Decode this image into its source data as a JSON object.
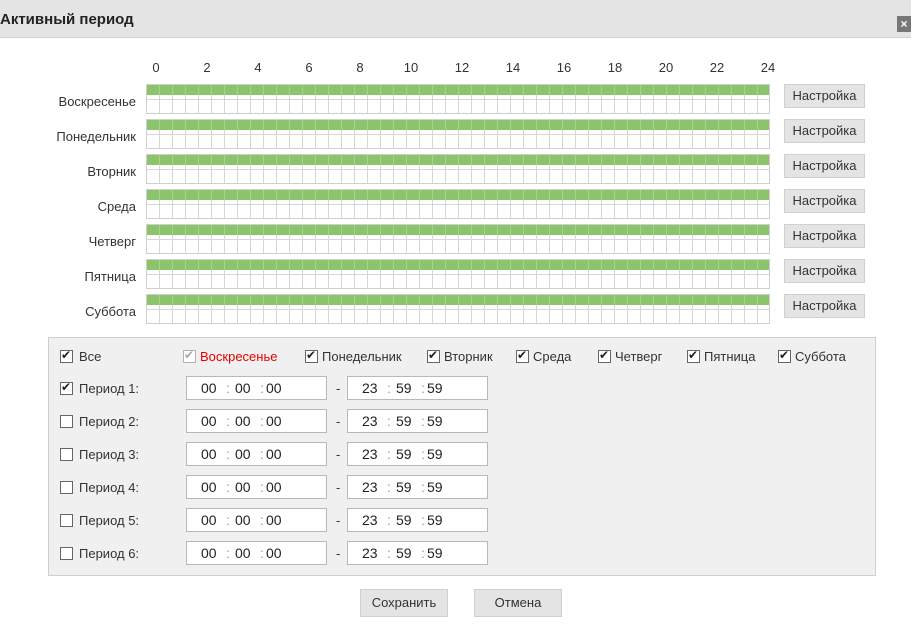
{
  "dialog": {
    "title": "Активный период",
    "close_glyph": "×"
  },
  "schedule": {
    "hour_labels": [
      "0",
      "2",
      "4",
      "6",
      "8",
      "10",
      "12",
      "14",
      "16",
      "18",
      "20",
      "22",
      "24"
    ],
    "setup_label": "Настройка",
    "bar_color": "#8cc46b",
    "days": [
      {
        "name": "Воскресенье",
        "active_from_hour": 0,
        "active_to_hour": 24
      },
      {
        "name": "Понедельник",
        "active_from_hour": 0,
        "active_to_hour": 24
      },
      {
        "name": "Вторник",
        "active_from_hour": 0,
        "active_to_hour": 24
      },
      {
        "name": "Среда",
        "active_from_hour": 0,
        "active_to_hour": 24
      },
      {
        "name": "Четверг",
        "active_from_hour": 0,
        "active_to_hour": 24
      },
      {
        "name": "Пятница",
        "active_from_hour": 0,
        "active_to_hour": 24
      },
      {
        "name": "Суббота",
        "active_from_hour": 0,
        "active_to_hour": 24
      }
    ]
  },
  "copy_to": {
    "all": {
      "label": "Все",
      "checked": true
    },
    "days": [
      {
        "label": "Воскресенье",
        "checked": true,
        "disabled": true,
        "current": true
      },
      {
        "label": "Понедельник",
        "checked": true
      },
      {
        "label": "Вторник",
        "checked": true
      },
      {
        "label": "Среда",
        "checked": true
      },
      {
        "label": "Четверг",
        "checked": true
      },
      {
        "label": "Пятница",
        "checked": true
      },
      {
        "label": "Суббота",
        "checked": true
      }
    ],
    "current_day_color": "#e60000"
  },
  "periods": [
    {
      "label": "Период 1:",
      "checked": true,
      "start": [
        "00",
        "00",
        "00"
      ],
      "end": [
        "23",
        "59",
        "59"
      ]
    },
    {
      "label": "Период 2:",
      "checked": false,
      "start": [
        "00",
        "00",
        "00"
      ],
      "end": [
        "23",
        "59",
        "59"
      ]
    },
    {
      "label": "Период 3:",
      "checked": false,
      "start": [
        "00",
        "00",
        "00"
      ],
      "end": [
        "23",
        "59",
        "59"
      ]
    },
    {
      "label": "Период 4:",
      "checked": false,
      "start": [
        "00",
        "00",
        "00"
      ],
      "end": [
        "23",
        "59",
        "59"
      ]
    },
    {
      "label": "Период 5:",
      "checked": false,
      "start": [
        "00",
        "00",
        "00"
      ],
      "end": [
        "23",
        "59",
        "59"
      ]
    },
    {
      "label": "Период 6:",
      "checked": false,
      "start": [
        "00",
        "00",
        "00"
      ],
      "end": [
        "23",
        "59",
        "59"
      ]
    }
  ],
  "period_separator": "-",
  "time_separator": ":",
  "footer": {
    "save_label": "Сохранить",
    "cancel_label": "Отмена"
  }
}
